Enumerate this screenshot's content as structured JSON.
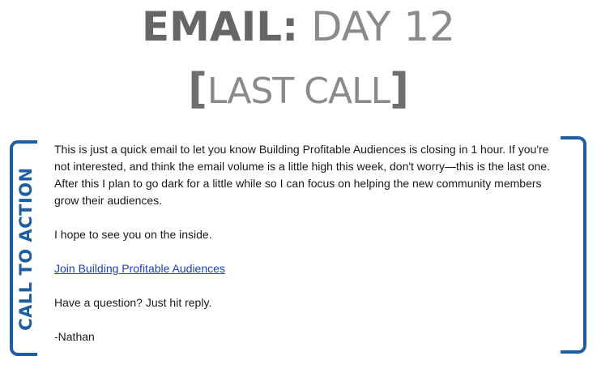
{
  "header": {
    "title_strong": "EMAIL:",
    "title_light": "DAY 12",
    "bracket_open": "[",
    "subtitle": "LAST CALL",
    "bracket_close": "]"
  },
  "side_label": "CALL TO ACTION",
  "email": {
    "paragraph_1": "This is just a quick email to let you know Building Profitable Audiences is closing in 1 hour. If you're not interested, and think the email volume is a little high this week, don't worry—this is the last one. After this I plan to go dark for a little while so I can focus on helping the new community members grow their audiences.",
    "paragraph_2": "I hope to see you on the inside.",
    "link": "Join Building Profitable Audiences",
    "paragraph_3": "Have a question? Just hit reply.",
    "signature": "-Nathan"
  },
  "colors": {
    "accent_blue": "#1f5fa0",
    "title_gray": "#6b6b6b",
    "link_blue": "#1a3fb3"
  }
}
